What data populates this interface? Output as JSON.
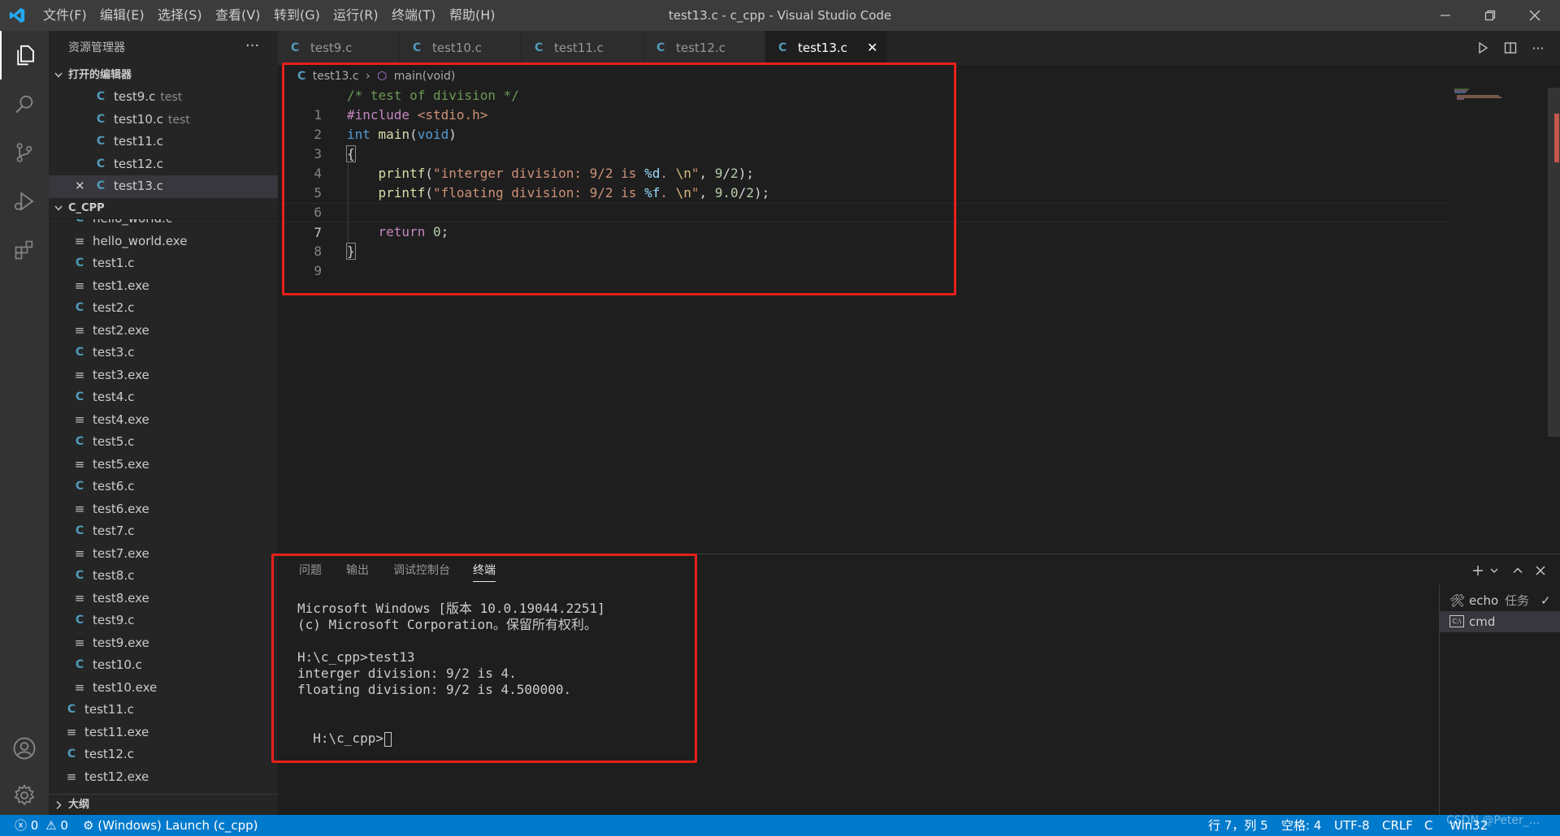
{
  "titlebar": {
    "title": "test13.c - c_cpp - Visual Studio Code",
    "menu": [
      "文件(F)",
      "编辑(E)",
      "选择(S)",
      "查看(V)",
      "转到(G)",
      "运行(R)",
      "终端(T)",
      "帮助(H)"
    ]
  },
  "sidebar": {
    "header": "资源管理器",
    "open_editors_label": "打开的编辑器",
    "open_editors": [
      {
        "name": "test9.c",
        "desc": "test"
      },
      {
        "name": "test10.c",
        "desc": "test"
      },
      {
        "name": "test11.c",
        "desc": ""
      },
      {
        "name": "test12.c",
        "desc": ""
      },
      {
        "name": "test13.c",
        "desc": ""
      }
    ],
    "folder_label": "C_CPP",
    "files": [
      "hello_world.c",
      "hello_world.exe",
      "test1.c",
      "test1.exe",
      "test2.c",
      "test2.exe",
      "test3.c",
      "test3.exe",
      "test4.c",
      "test4.exe",
      "test5.c",
      "test5.exe",
      "test6.c",
      "test6.exe",
      "test7.c",
      "test7.exe",
      "test8.c",
      "test8.exe",
      "test9.c",
      "test9.exe",
      "test10.c",
      "test10.exe",
      "test11.c",
      "test11.exe",
      "test12.c",
      "test12.exe"
    ],
    "outline_label": "大纲"
  },
  "tabs": [
    "test9.c",
    "test10.c",
    "test11.c",
    "test12.c",
    "test13.c"
  ],
  "active_tab": "test13.c",
  "breadcrumb": {
    "file": "test13.c",
    "symbol": "main(void)"
  },
  "editor": {
    "line_numbers": [
      "1",
      "2",
      "3",
      "4",
      "5",
      "6",
      "7",
      "8",
      "9"
    ],
    "current_line": 7,
    "code": {
      "l1_comment": "/* test of division */",
      "l2_pre": "#include",
      "l2_inc": " <stdio.h>",
      "l3_kw_int": "int",
      "l3_fn": "main",
      "l3_open": "(",
      "l3_kw_void": "void",
      "l3_close": ")",
      "l4": "{",
      "l5_indent": "    ",
      "l5_fn": "printf",
      "l5_open": "(",
      "l5_str1": "\"interger division: 9/2 is ",
      "l5_fmt": "%d",
      "l5_str2": ". ",
      "l5_esc": "\\n",
      "l5_str3": "\"",
      "l5_rest": ", ",
      "l5_num1": "9",
      "l5_div": "/",
      "l5_num2": "2",
      "l5_end": ");",
      "l6_indent": "    ",
      "l6_fn": "printf",
      "l6_open": "(",
      "l6_str1": "\"floating division: 9/2 is ",
      "l6_fmt": "%f",
      "l6_str2": ". ",
      "l6_esc": "\\n",
      "l6_str3": "\"",
      "l6_rest": ", ",
      "l6_num1": "9.0",
      "l6_div": "/",
      "l6_num2": "2",
      "l6_end": ");",
      "l8_indent": "    ",
      "l8_kw": "return",
      "l8_sp": " ",
      "l8_num": "0",
      "l8_end": ";",
      "l9": "}"
    }
  },
  "panel": {
    "tabs": [
      "问题",
      "输出",
      "调试控制台",
      "终端"
    ],
    "active_tab": "终端",
    "terminal_lines": [
      "Microsoft Windows [版本 10.0.19044.2251]",
      "(c) Microsoft Corporation。保留所有权利。",
      "",
      "H:\\c_cpp>test13",
      "interger division: 9/2 is 4.",
      "floating division: 9/2 is 4.500000.",
      "",
      "H:\\c_cpp>"
    ],
    "terminals": [
      {
        "name": "echo",
        "tag": "任务"
      },
      {
        "name": "cmd",
        "tag": ""
      }
    ]
  },
  "statusbar": {
    "errors": "0",
    "warnings": "0",
    "launch": "(Windows) Launch (c_cpp)",
    "position": "行 7，列 5",
    "spaces": "空格: 4",
    "encoding": "UTF-8",
    "eol": "CRLF",
    "language": "C",
    "platform": "Win32"
  },
  "watermark": "CSDN @Peter_..."
}
